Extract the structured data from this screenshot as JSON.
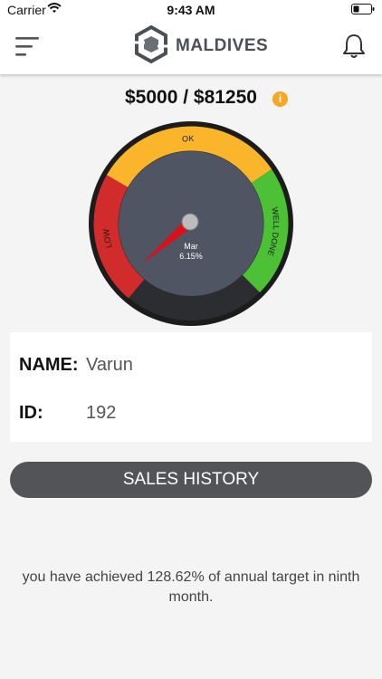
{
  "status_bar": {
    "carrier": "Carrier",
    "time": "9:43 AM"
  },
  "header": {
    "brand_name": "MALDIVES",
    "icons": [
      "menu-icon",
      "logo-icon",
      "bell-icon"
    ]
  },
  "summary": {
    "target_text": "$5000 / $81250",
    "info_badge": "i",
    "info_color": "#f5a623"
  },
  "gauge": {
    "zones": [
      {
        "label": "LOW",
        "color": "#d12b2b"
      },
      {
        "label": "OK",
        "color": "#fbb52a"
      },
      {
        "label": "WELL DONE",
        "color": "#4cc136"
      }
    ],
    "month": "Mar",
    "percent_text": "6.15%",
    "needle_color": "#d6131a",
    "dial_color": "#4f5562"
  },
  "profile": {
    "name_label": "NAME:",
    "name_value": "Varun",
    "id_label": "ID:",
    "id_value": "192"
  },
  "actions": {
    "sales_history_label": "SALES HISTORY"
  },
  "footer": {
    "message": "you have achieved 128.62% of annual target in ninth month."
  }
}
